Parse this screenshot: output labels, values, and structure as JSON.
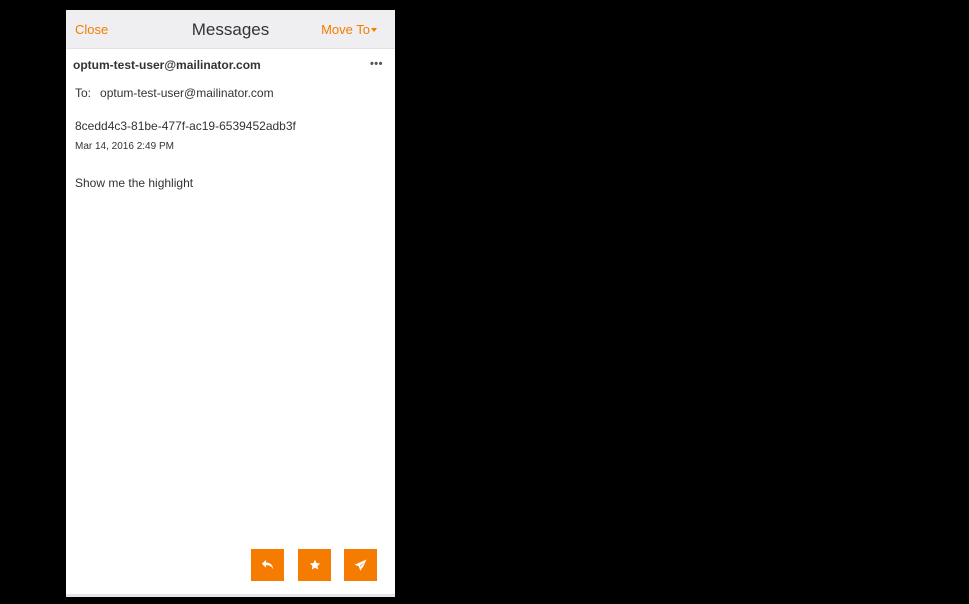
{
  "header": {
    "close_label": "Close",
    "title": "Messages",
    "move_to_label": "Move To"
  },
  "message": {
    "sender": "optum-test-user@mailinator.com",
    "more_label": "•••",
    "to_label": "To:",
    "to_address": "optum-test-user@mailinator.com",
    "subject": "8cedd4c3-81be-477f-ac19-6539452adb3f",
    "date": "Mar 14, 2016 2:49 PM",
    "body": "Show me the highlight"
  },
  "actions": [
    {
      "name": "reply",
      "icon": "reply-icon"
    },
    {
      "name": "star",
      "icon": "star-icon"
    },
    {
      "name": "send",
      "icon": "send-icon"
    }
  ],
  "colors": {
    "accent": "#f57c00",
    "header_bg": "#efeff1",
    "text": "#333333",
    "background": "#000000"
  }
}
